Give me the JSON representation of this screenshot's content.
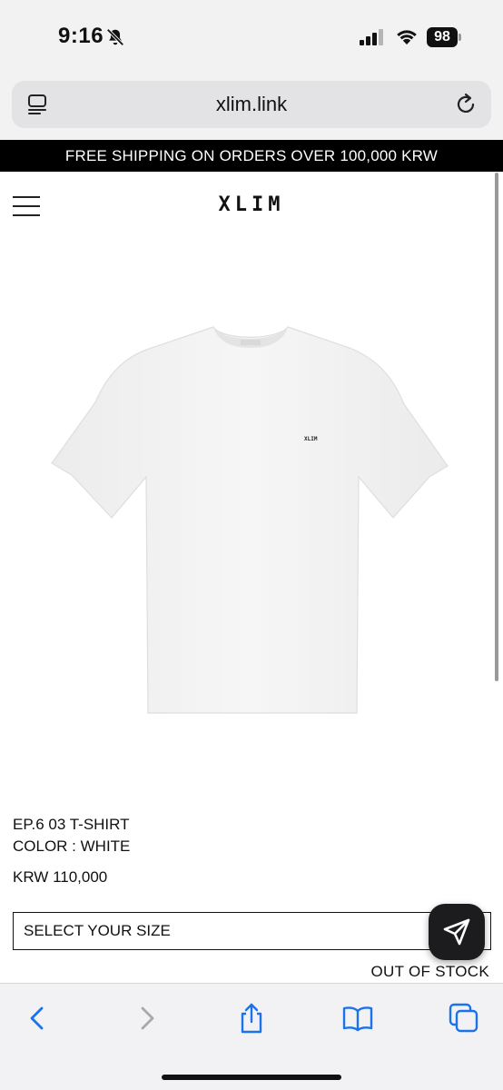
{
  "status_bar": {
    "time": "9:16",
    "battery": "98",
    "icons": [
      "bell-slash-icon",
      "cellular-signal-icon",
      "wifi-icon",
      "battery-icon"
    ]
  },
  "browser": {
    "url": "xlim.link",
    "icons": [
      "tabs-icon",
      "reload-icon"
    ]
  },
  "announcement": "FREE SHIPPING ON ORDERS OVER 100,000 KRW",
  "header": {
    "logo": "XLIM",
    "menu_icon": "hamburger-menu-icon"
  },
  "product": {
    "name": "EP.6 03 T-SHIRT",
    "color": "COLOR : WHITE",
    "price": "KRW 110,000",
    "chest_logo": "XLIM",
    "size_select_label": "SELECT YOUR SIZE",
    "stock_status": "OUT OF STOCK",
    "image_color": "#f4f4f4"
  },
  "floating_button": {
    "icon": "send-arrow-icon",
    "color": "#1c1c1e"
  },
  "toolbar": {
    "items": [
      "back-icon",
      "forward-icon",
      "share-icon",
      "bookmarks-icon",
      "tabs-overview-icon"
    ],
    "accent": "#1a73e8"
  }
}
